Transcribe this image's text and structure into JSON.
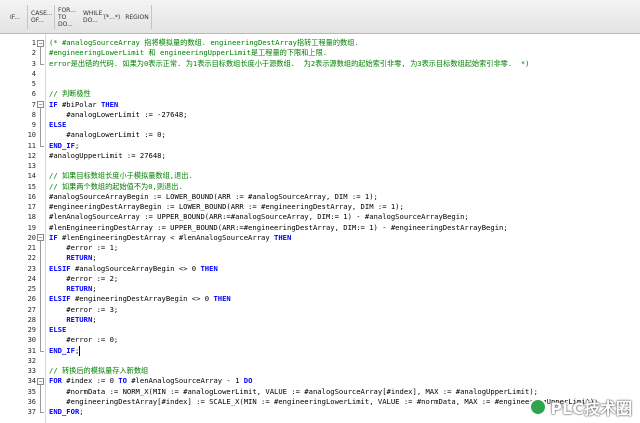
{
  "toolbar": [
    {
      "id": "if",
      "label": "IF..."
    },
    {
      "id": "case",
      "label": "CASE... OF..."
    },
    {
      "id": "for",
      "label": "FOR... TO DO..."
    },
    {
      "id": "while",
      "label": "WHILE... DO..."
    },
    {
      "id": "comment",
      "label": "(*...*)"
    },
    {
      "id": "region",
      "label": "REGION"
    }
  ],
  "lines": [
    {
      "n": "1",
      "html": "<span class=\"cm\">(* #analogSourceArray 指将模拟量的数组. engineeringDestArray指转工程量的数组.</span>"
    },
    {
      "n": "2",
      "html": "<span class=\"cm\">#engineeringLowerLimit 和 engineeringUpperLimit是工程量的下限和上限.</span>"
    },
    {
      "n": "3",
      "html": "<span class=\"cm\">error是出错的代码. 如果为0表示正常. 为1表示目标数组长度小于源数组.  为2表示源数组的起始索引非零, 为3表示目标数组起始索引非零.  *)</span>"
    },
    {
      "n": "4",
      "html": ""
    },
    {
      "n": "5",
      "html": ""
    },
    {
      "n": "6",
      "html": "<span class=\"cm\">// 判断极性</span>"
    },
    {
      "n": "7",
      "html": "<span class=\"kw\">IF</span> #biPolar <span class=\"kw\">THEN</span>"
    },
    {
      "n": "8",
      "html": "    #analogLowerLimit := -27648;"
    },
    {
      "n": "9",
      "html": "<span class=\"kw\">ELSE</span>"
    },
    {
      "n": "10",
      "html": "    #analogLowerLimit := 0;"
    },
    {
      "n": "11",
      "html": "<span class=\"kw\">END_IF</span>;"
    },
    {
      "n": "12",
      "html": "#analogUpperLimit := 27648;"
    },
    {
      "n": "13",
      "html": ""
    },
    {
      "n": "14",
      "html": "<span class=\"cm\">// 如果目标数组长度小于模拟量数组,退出.</span>"
    },
    {
      "n": "15",
      "html": "<span class=\"cm\">// 如果两个数组的起始值不为0,则退出.</span>"
    },
    {
      "n": "16",
      "html": "#analogSourceArrayBegin := LOWER_BOUND(ARR := #analogSourceArray, DIM := 1);"
    },
    {
      "n": "17",
      "html": "#engineeringDestArrayBegin := LOWER_BOUND(ARR := #engineeringDestArray, DIM := 1);"
    },
    {
      "n": "18",
      "html": "#lenAnalogSourceArray := UPPER_BOUND(ARR:=#analogSourceArray, DIM:= 1) - #analogSourceArrayBegin;"
    },
    {
      "n": "19",
      "html": "#lenEngineeringDestArray := UPPER_BOUND(ARR:=#engineeringDestArray, DIM:= 1) - #engineeringDestArrayBegin;"
    },
    {
      "n": "20",
      "html": "<span class=\"kw\">IF</span> #lenEngineeringDestArray &lt; #lenAnalogSourceArray <span class=\"kw\">THEN</span>"
    },
    {
      "n": "21",
      "html": "    #error := 1;"
    },
    {
      "n": "22",
      "html": "    <span class=\"kw\">RETURN</span>;"
    },
    {
      "n": "23",
      "html": "<span class=\"kw\">ELSIF</span> #analogSourceArrayBegin &lt;&gt; 0 <span class=\"kw\">THEN</span>"
    },
    {
      "n": "24",
      "html": "    #error := 2;"
    },
    {
      "n": "25",
      "html": "    <span class=\"kw\">RETURN</span>;"
    },
    {
      "n": "26",
      "html": "<span class=\"kw\">ELSIF</span> #engineeringDestArrayBegin &lt;&gt; 0 <span class=\"kw\">THEN</span>"
    },
    {
      "n": "27",
      "html": "    #error := 3;"
    },
    {
      "n": "28",
      "html": "    <span class=\"kw\">RETURN</span>;"
    },
    {
      "n": "29",
      "html": "<span class=\"kw\">ELSE</span>"
    },
    {
      "n": "30",
      "html": "    #error := 0;"
    },
    {
      "n": "31",
      "html": "<span class=\"kw\">END_IF</span>;<span class=\"caret\"></span>"
    },
    {
      "n": "32",
      "html": ""
    },
    {
      "n": "33",
      "html": "<span class=\"cm\">// 转换后的模拟量存入新数组</span>"
    },
    {
      "n": "34",
      "html": "<span class=\"kw\">FOR</span> #index := 0 <span class=\"kw\">TO</span> #lenAnalogSourceArray - 1 <span class=\"kw\">DO</span>"
    },
    {
      "n": "35",
      "html": "    #normData := NORM_X(MIN := #analogLowerLimit, VALUE := #analogSourceArray[#index], MAX := #analogUpperLimit);"
    },
    {
      "n": "36",
      "html": "    #engineeringDestArray[#index] := SCALE_X(MIN := #engineeringLowerLimit, VALUE := #normData, MAX := #engineeringUpperLimit);"
    },
    {
      "n": "37",
      "html": "<span class=\"kw\">END_FOR</span>;"
    }
  ],
  "watermark": "PLC技术圈"
}
